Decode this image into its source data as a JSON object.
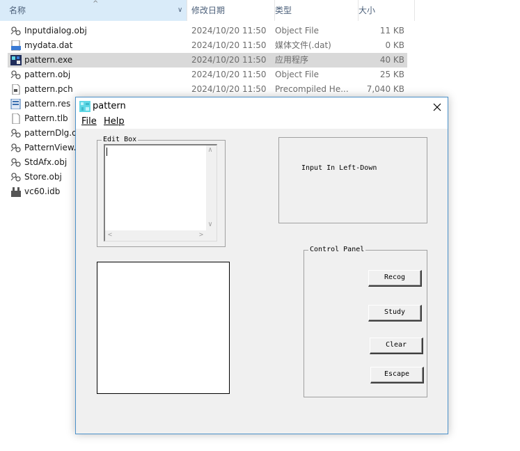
{
  "explorer": {
    "columns": {
      "name": "名称",
      "date": "修改日期",
      "type": "类型",
      "size": "大小"
    },
    "files": [
      {
        "name": "Inputdialog.obj",
        "date": "2024/10/20 11:50",
        "type": "Object File",
        "size": "11 KB",
        "icon": "obj-file-icon",
        "selected": false
      },
      {
        "name": "mydata.dat",
        "date": "2024/10/20 11:50",
        "type": "媒体文件(.dat)",
        "size": "0 KB",
        "icon": "dat-file-icon",
        "selected": false
      },
      {
        "name": "pattern.exe",
        "date": "2024/10/20 11:50",
        "type": "应用程序",
        "size": "40 KB",
        "icon": "exe-file-icon",
        "selected": true
      },
      {
        "name": "pattern.obj",
        "date": "2024/10/20 11:50",
        "type": "Object File",
        "size": "25 KB",
        "icon": "obj-file-icon",
        "selected": false
      },
      {
        "name": "pattern.pch",
        "date": "2024/10/20 11:50",
        "type": "Precompiled He...",
        "size": "7,040 KB",
        "icon": "pch-file-icon",
        "selected": false
      },
      {
        "name": "pattern.res",
        "date": "",
        "type": "",
        "size": "",
        "icon": "res-file-icon",
        "selected": false
      },
      {
        "name": "Pattern.tlb",
        "date": "",
        "type": "",
        "size": "",
        "icon": "blank-file-icon",
        "selected": false
      },
      {
        "name": "patternDlg.o",
        "date": "",
        "type": "",
        "size": "",
        "icon": "obj-file-icon",
        "selected": false
      },
      {
        "name": "PatternView.o",
        "date": "",
        "type": "",
        "size": "",
        "icon": "obj-file-icon",
        "selected": false
      },
      {
        "name": "StdAfx.obj",
        "date": "",
        "type": "",
        "size": "",
        "icon": "obj-file-icon",
        "selected": false
      },
      {
        "name": "Store.obj",
        "date": "",
        "type": "",
        "size": "",
        "icon": "obj-file-icon",
        "selected": false
      },
      {
        "name": "vc60.idb",
        "date": "",
        "type": "",
        "size": "",
        "icon": "idb-file-icon",
        "selected": false
      }
    ]
  },
  "dialog": {
    "title": "pattern",
    "menu": {
      "file": "File",
      "help": "Help"
    },
    "edit_box_label": "Edit Box",
    "edit_box_value": "",
    "info_text": "Input In Left-Down",
    "control_panel_label": "Control Panel",
    "buttons": {
      "recog": "Recog",
      "study": "Study",
      "clear": "Clear",
      "escape": "Escape"
    }
  },
  "colors": {
    "header_highlight": "#d9ebf9",
    "selected_row": "#d9d9d9",
    "dialog_bg": "#f0f0f0",
    "dialog_border": "#4a90c9"
  }
}
